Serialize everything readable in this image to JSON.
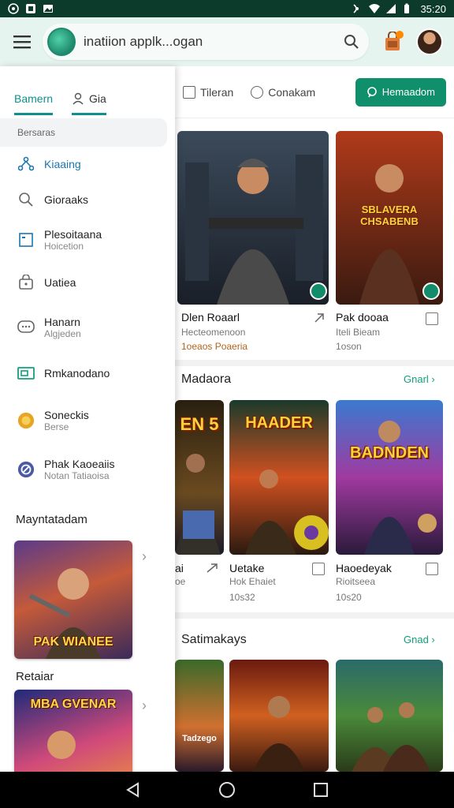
{
  "status_bar": {
    "time": "35:20"
  },
  "topbar": {
    "search_text": "inatiion applk...ogan"
  },
  "tabs": [
    {
      "label": "Tileran"
    },
    {
      "label": "Conakam"
    }
  ],
  "action_button": {
    "label": "Hemaadom"
  },
  "drawer": {
    "tabs": [
      {
        "label": "Bamern"
      },
      {
        "label": "Gia"
      }
    ],
    "heading": "Bersaras",
    "items": [
      {
        "label": "Kiaaing",
        "sub": "",
        "icon": "network-icon"
      },
      {
        "label": "Gioraaks",
        "sub": "",
        "icon": "search-icon"
      },
      {
        "label": "Plesoitaana",
        "sub": "Hoicetion",
        "icon": "document-icon"
      },
      {
        "label": "Uatiea",
        "sub": "",
        "icon": "lock-icon"
      },
      {
        "label": "Hanarn",
        "sub": "Algjeden",
        "icon": "chat-icon"
      },
      {
        "label": "Rmkanodano",
        "sub": "",
        "icon": "card-icon"
      },
      {
        "label": "Soneckis",
        "sub": "Berse",
        "icon": "coin-icon"
      },
      {
        "label": "Phak Kaoeaiis",
        "sub": "Notan Tatiaoisa",
        "icon": "circle-slash-icon"
      }
    ],
    "section1": "Mayntatadam",
    "thumb1_title": "PAK WIANEE",
    "section2": "Retaiar",
    "thumb2_title": "MBA GVENAR"
  },
  "featured": [
    {
      "title": "Dlen Roaarl",
      "sub": "Hecteomenoon",
      "meta": "1oeaos Poaeria"
    },
    {
      "title": "Pak dooaa",
      "sub": "Iteli Bieam",
      "meta": "1oson",
      "poster_text": "SBLAVERA CHSABENB"
    }
  ],
  "section_a": {
    "title": "Madaora",
    "link": "Gnarl",
    "items": [
      {
        "title": "ai",
        "sub": "oe",
        "meta": "",
        "poster_text": "EN 5"
      },
      {
        "title": "Uetake",
        "sub": "Hok Ehaiet",
        "meta": "10s32",
        "poster_text": "HAADER"
      },
      {
        "title": "Haoedeyak",
        "sub": "Rioitseea",
        "meta": "10s20",
        "poster_text": "BADNDEN"
      }
    ]
  },
  "section_b": {
    "title": "Satimakays",
    "link": "Gnad",
    "items": [
      {
        "poster_text": "Tadzego"
      },
      {
        "poster_text": ""
      },
      {
        "poster_text": ""
      }
    ]
  }
}
